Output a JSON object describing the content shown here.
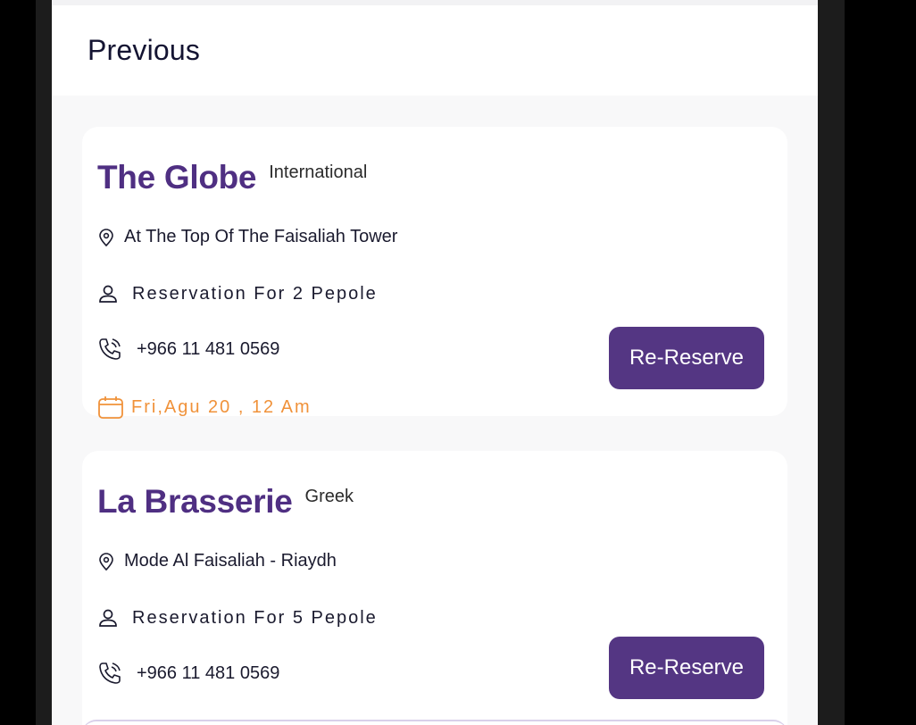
{
  "header": {
    "title": "Previous"
  },
  "reservations": [
    {
      "name": "The Globe",
      "cuisine": "International",
      "location": "At The Top Of The Faisaliah Tower",
      "party": "Reservation For 2 Pepole",
      "phone": "+966 11 481 0569",
      "date": "Fri,Agu 20 , 12 Am",
      "button_label": "Re-Reserve"
    },
    {
      "name": "La Brasserie",
      "cuisine": "Greek",
      "location": "Mode Al Faisaliah - Riaydh",
      "party": "Reservation For 5 Pepole",
      "phone": "+966 11 481 0569",
      "button_label": "Re-Reserve"
    }
  ],
  "colors": {
    "brand_purple": "#543683",
    "name_purple": "#4f2f82",
    "date_orange": "#f0923a"
  },
  "icons": [
    "location-pin-icon",
    "person-icon",
    "phone-icon",
    "calendar-icon"
  ]
}
